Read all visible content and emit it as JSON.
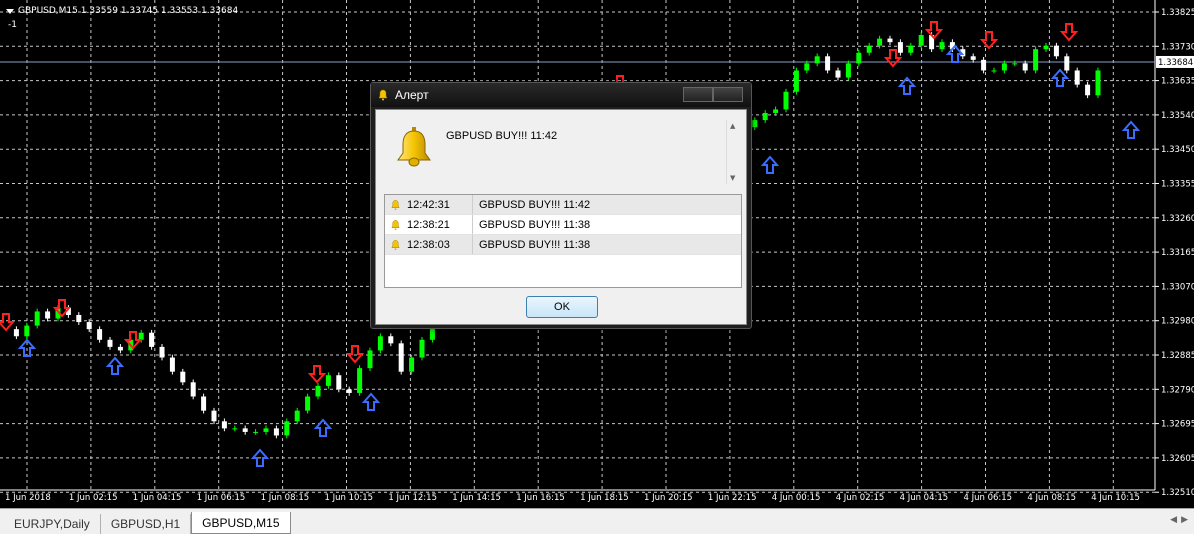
{
  "chart": {
    "symbol_text": "GBPUSD,M15  1.33559 1.33745 1.33553 1.33684",
    "sub_value": "-1",
    "current_price": "1.33684",
    "price_labels": [
      "1.33825",
      "1.33730",
      "1.33635",
      "1.33540",
      "1.33450",
      "1.33355",
      "1.33260",
      "1.33165",
      "1.33070",
      "1.32980",
      "1.32885",
      "1.32790",
      "1.32695",
      "1.32605",
      "1.32510"
    ],
    "time_labels": [
      "1 Jun 2018",
      "1 Jun 02:15",
      "1 Jun 04:15",
      "1 Jun 06:15",
      "1 Jun 08:15",
      "1 Jun 10:15",
      "1 Jun 12:15",
      "1 Jun 14:15",
      "1 Jun 16:15",
      "1 Jun 18:15",
      "1 Jun 20:15",
      "1 Jun 22:15",
      "4 Jun 00:15",
      "4 Jun 02:15",
      "4 Jun 04:15",
      "4 Jun 06:15",
      "4 Jun 08:15",
      "4 Jun 10:15"
    ],
    "colors": {
      "background": "#000000",
      "grid": "#c8c8c8",
      "bull": "#00ff00",
      "bear": "#ffffff",
      "buy_arrow": "#3a6cff",
      "sell_arrow": "#ff2020",
      "price_line": "#8aa0c8"
    }
  },
  "dialog": {
    "title": "Алерт",
    "icon": "bell-icon",
    "message": "GBPUSD BUY!!! 11:42",
    "ok_label": "OK",
    "alerts": [
      {
        "time": "12:42:31",
        "text": "GBPUSD BUY!!! 11:42"
      },
      {
        "time": "12:38:21",
        "text": "GBPUSD BUY!!! 11:38"
      },
      {
        "time": "12:38:03",
        "text": "GBPUSD BUY!!! 11:38"
      }
    ]
  },
  "tabs": [
    {
      "label": "EURJPY,Daily",
      "active": false
    },
    {
      "label": "GBPUSD,H1",
      "active": false
    },
    {
      "label": "GBPUSD,M15",
      "active": true
    }
  ]
}
